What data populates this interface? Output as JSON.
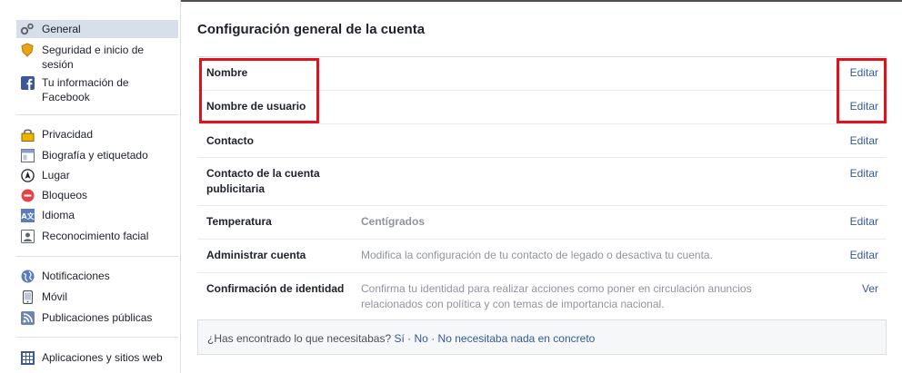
{
  "sidebar": {
    "items": [
      {
        "label": "General",
        "icon": "gears-icon"
      },
      {
        "label": "Seguridad e inicio de sesión",
        "icon": "shield-badge-icon"
      },
      {
        "label": "Tu información de Facebook",
        "icon": "facebook-icon"
      },
      {
        "label": "Privacidad",
        "icon": "lock-icon"
      },
      {
        "label": "Biografía y etiquetado",
        "icon": "timeline-icon"
      },
      {
        "label": "Lugar",
        "icon": "location-icon"
      },
      {
        "label": "Bloqueos",
        "icon": "block-icon"
      },
      {
        "label": "Idioma",
        "icon": "language-icon"
      },
      {
        "label": "Reconocimiento facial",
        "icon": "face-recognition-icon"
      },
      {
        "label": "Notificaciones",
        "icon": "globe-icon"
      },
      {
        "label": "Móvil",
        "icon": "mobile-icon"
      },
      {
        "label": "Publicaciones públicas",
        "icon": "rss-icon"
      },
      {
        "label": "Aplicaciones y sitios web",
        "icon": "apps-icon"
      }
    ]
  },
  "main": {
    "title": "Configuración general de la cuenta",
    "rows": [
      {
        "label": "Nombre",
        "value": "",
        "action": "Editar"
      },
      {
        "label": "Nombre de usuario",
        "value": "",
        "action": "Editar"
      },
      {
        "label": "Contacto",
        "value": "",
        "action": "Editar"
      },
      {
        "label": "Contacto de la cuenta publicitaria",
        "value": "",
        "action": "Editar"
      },
      {
        "label": "Temperatura",
        "value": "Centígrados",
        "action": "Editar"
      },
      {
        "label": "Administrar cuenta",
        "value": "Modifica la configuración de tu contacto de legado o desactiva tu cuenta.",
        "action": "Editar"
      },
      {
        "label": "Confirmación de identidad",
        "value": "Confirma tu identidad para realizar acciones como poner en circulación anuncios relacionados con política y con temas de importancia nacional.",
        "action": "Ver"
      }
    ]
  },
  "feedback": {
    "question": "¿Has encontrado lo que necesitabas?",
    "yes": "Sí",
    "no": "No",
    "other": "No necesitaba nada en concreto",
    "separator": "·"
  },
  "colors": {
    "accent": "#365899",
    "highlight": "#e0121b",
    "active_bg": "#d8dfea"
  }
}
